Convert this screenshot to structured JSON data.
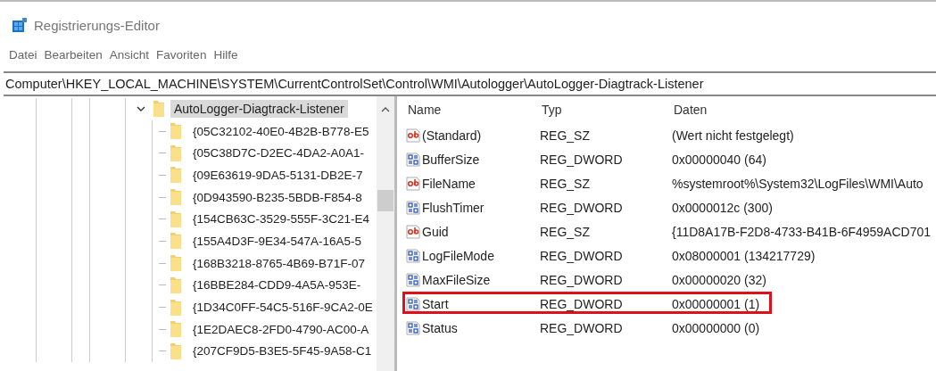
{
  "window": {
    "title": "Registrierungs-Editor"
  },
  "menu": [
    "Datei",
    "Bearbeiten",
    "Ansicht",
    "Favoriten",
    "Hilfe"
  ],
  "address": "Computer\\HKEY_LOCAL_MACHINE\\SYSTEM\\CurrentControlSet\\Control\\WMI\\Autologger\\AutoLogger-Diagtrack-Listener",
  "tree": {
    "items": [
      {
        "label": "AutoLogger-Diagtrack-Listener",
        "expanded": true,
        "selected": true,
        "children": [
          {
            "label": "{05C32102-40E0-4B2B-B778-E5"
          },
          {
            "label": "{05C38D7C-D2EC-4DA2-A0A1-"
          },
          {
            "label": "{09E63619-9DA5-5131-DB2E-7"
          },
          {
            "label": "{0D943590-B235-5BDB-F854-8"
          },
          {
            "label": "{154CB63C-3529-555F-3C21-E4"
          },
          {
            "label": "{155A4D3F-9E34-547A-16A5-5"
          },
          {
            "label": "{168B3218-8765-4B69-B71F-07"
          },
          {
            "label": "{16BBE284-CDD9-4A5A-953E-"
          },
          {
            "label": "{1D34C0FF-54C5-516F-9CA2-0E"
          },
          {
            "label": "{1E2DAEC8-2FD0-4790-AC00-A"
          },
          {
            "label": "{207CF9D5-B3E5-5F45-9A58-C1"
          }
        ]
      }
    ]
  },
  "table": {
    "columns": [
      "Name",
      "Typ",
      "Daten"
    ],
    "rows": [
      {
        "kind": "string",
        "name": "(Standard)",
        "type": "REG_SZ",
        "data": "(Wert nicht festgelegt)",
        "highlighted": false
      },
      {
        "kind": "dword",
        "name": "BufferSize",
        "type": "REG_DWORD",
        "data": "0x00000040 (64)",
        "highlighted": false
      },
      {
        "kind": "string",
        "name": "FileName",
        "type": "REG_SZ",
        "data": "%systemroot%\\System32\\LogFiles\\WMI\\Auto",
        "highlighted": false
      },
      {
        "kind": "dword",
        "name": "FlushTimer",
        "type": "REG_DWORD",
        "data": "0x0000012c (300)",
        "highlighted": false
      },
      {
        "kind": "string",
        "name": "Guid",
        "type": "REG_SZ",
        "data": "{11D8A17B-F2D8-4733-B41B-6F4959ACD701",
        "highlighted": false
      },
      {
        "kind": "dword",
        "name": "LogFileMode",
        "type": "REG_DWORD",
        "data": "0x08000001 (134217729)",
        "highlighted": false
      },
      {
        "kind": "dword",
        "name": "MaxFileSize",
        "type": "REG_DWORD",
        "data": "0x00000020 (32)",
        "highlighted": false
      },
      {
        "kind": "dword",
        "name": "Start",
        "type": "REG_DWORD",
        "data": "0x00000001 (1)",
        "highlighted": true
      },
      {
        "kind": "dword",
        "name": "Status",
        "type": "REG_DWORD",
        "data": "0x00000000 (0)",
        "highlighted": false
      }
    ]
  }
}
